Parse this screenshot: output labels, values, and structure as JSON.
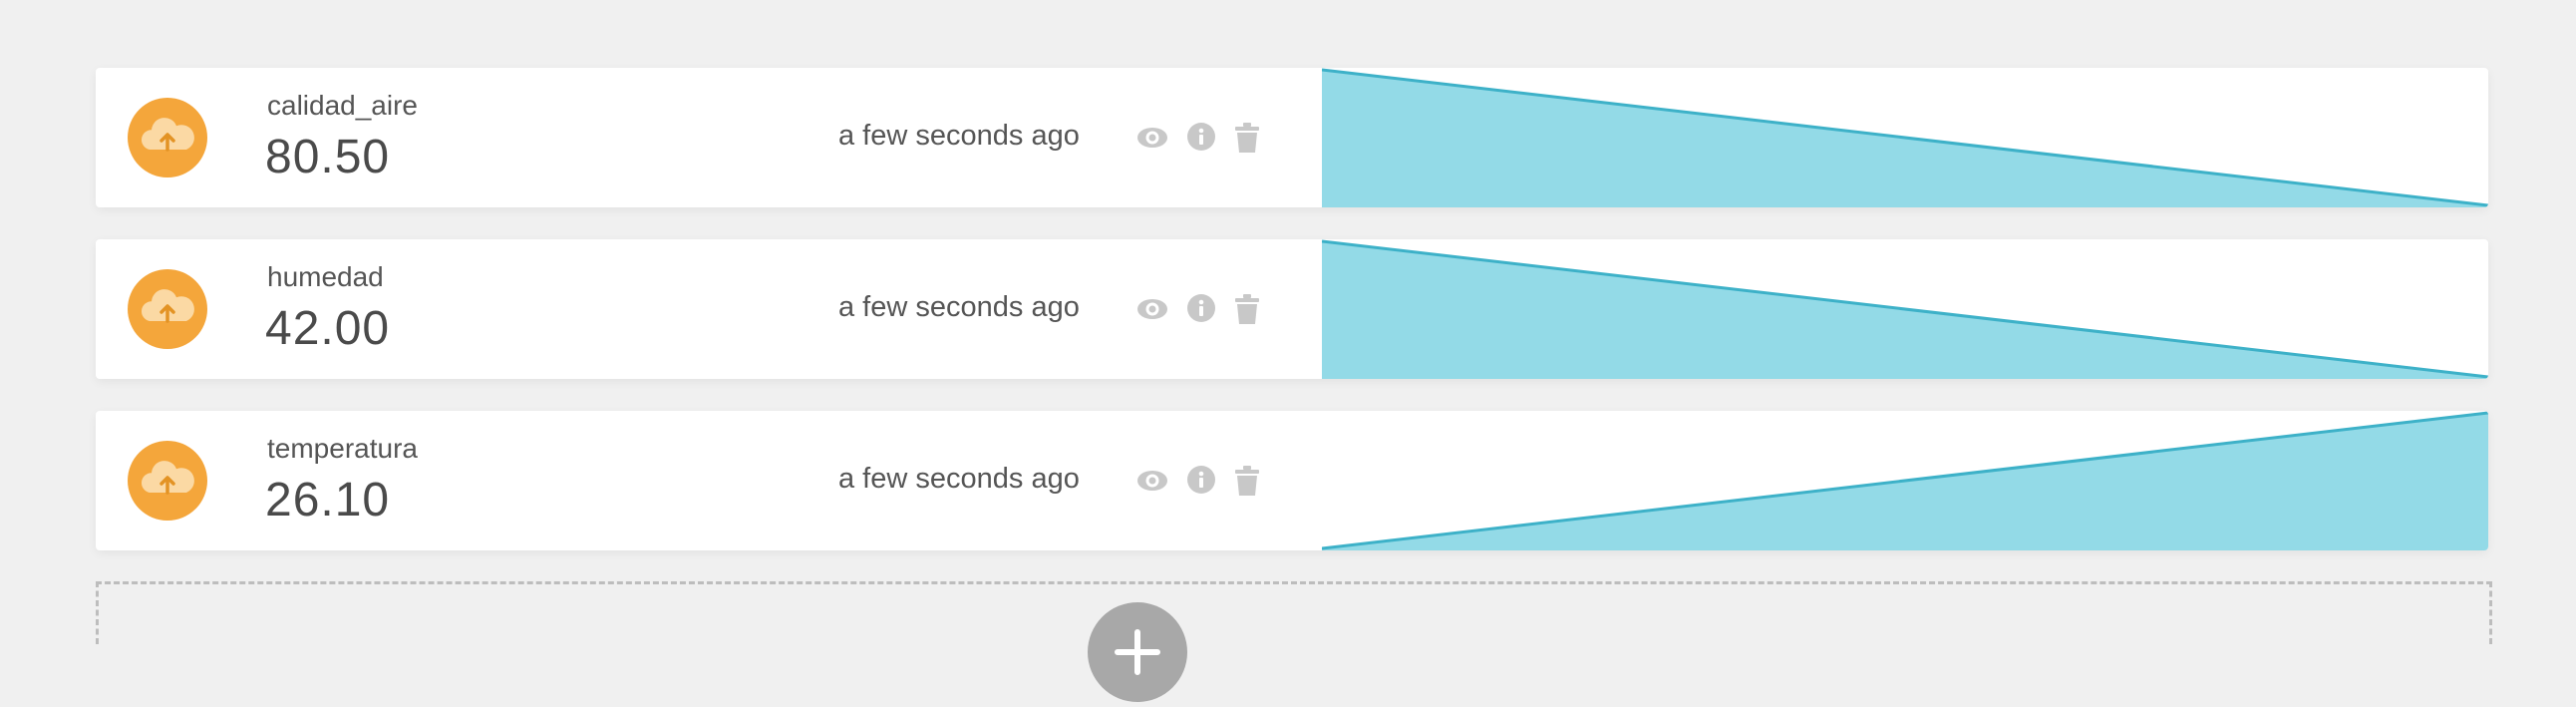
{
  "colors": {
    "page_background": "#f0f0f0",
    "card_background": "#ffffff",
    "avatar": "#f4a63b",
    "sparkline_fill": "#93dae7",
    "sparkline_stroke": "#3db1c8",
    "action_icon": "#c8c8c8",
    "add_button": "#a8a8a8"
  },
  "variables": [
    {
      "name": "calidad_aire",
      "value": "80.50",
      "last_updated": "a few seconds ago",
      "icon": "cloud-upload-icon",
      "actions": [
        "eye-icon",
        "info-icon",
        "trash-icon"
      ],
      "sparkline": {
        "trend": "decreasing",
        "values": [
          1,
          0
        ]
      }
    },
    {
      "name": "humedad",
      "value": "42.00",
      "last_updated": "a few seconds ago",
      "icon": "cloud-upload-icon",
      "actions": [
        "eye-icon",
        "info-icon",
        "trash-icon"
      ],
      "sparkline": {
        "trend": "decreasing",
        "values": [
          1,
          0
        ]
      }
    },
    {
      "name": "temperatura",
      "value": "26.10",
      "last_updated": "a few seconds ago",
      "icon": "cloud-upload-icon",
      "actions": [
        "eye-icon",
        "info-icon",
        "trash-icon"
      ],
      "sparkline": {
        "trend": "increasing",
        "values": [
          0,
          1
        ]
      }
    }
  ],
  "add_variable": {
    "icon": "add-icon"
  }
}
